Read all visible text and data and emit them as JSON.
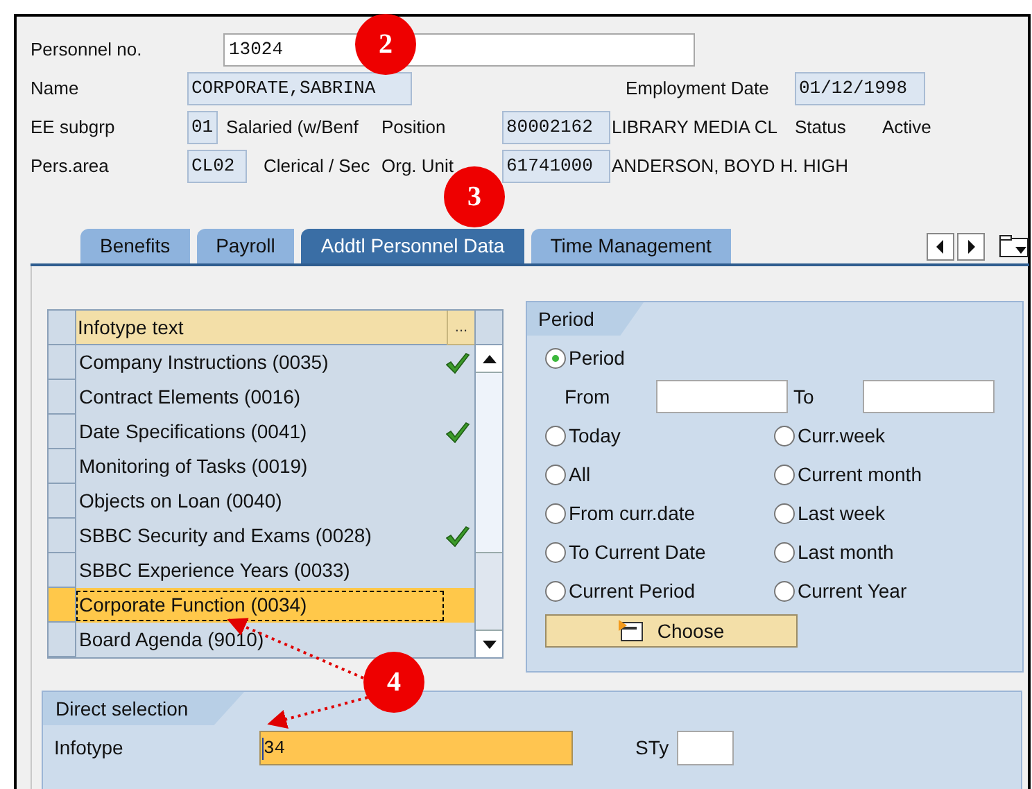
{
  "header": {
    "personnel_no": {
      "label": "Personnel no.",
      "value": "13024"
    },
    "name": {
      "label": "Name",
      "value": "CORPORATE,SABRINA"
    },
    "employment_date": {
      "label": "Employment Date",
      "value": "01/12/1998"
    },
    "ee_subgrp": {
      "label": "EE subgrp",
      "value": "01",
      "text": "Salaried (w/Benf"
    },
    "position": {
      "label": "Position",
      "value": "80002162",
      "text": "LIBRARY MEDIA CL"
    },
    "status": {
      "label": "Status",
      "text": "Active"
    },
    "pers_area": {
      "label": "Pers.area",
      "value": "CL02",
      "text": "Clerical / Sec"
    },
    "org_unit": {
      "label": "Org. Unit",
      "value": "61741000",
      "text": "ANDERSON, BOYD H. HIGH"
    }
  },
  "tabs": [
    {
      "label": "Benefits",
      "selected": false
    },
    {
      "label": "Payroll",
      "selected": false
    },
    {
      "label": "Addtl Personnel Data",
      "selected": true
    },
    {
      "label": "Time Management",
      "selected": false
    }
  ],
  "infotype_table": {
    "column": "Infotype text",
    "column_menu": "...",
    "rows": [
      {
        "text": "Company Instructions (0035)",
        "checked": true,
        "selected": false
      },
      {
        "text": "Contract Elements (0016)",
        "checked": false,
        "selected": false
      },
      {
        "text": "Date Specifications (0041)",
        "checked": true,
        "selected": false
      },
      {
        "text": "Monitoring of Tasks (0019)",
        "checked": false,
        "selected": false
      },
      {
        "text": "Objects on Loan (0040)",
        "checked": false,
        "selected": false
      },
      {
        "text": "SBBC Security and Exams (0028)",
        "checked": true,
        "selected": false
      },
      {
        "text": "SBBC Experience Years (0033)",
        "checked": false,
        "selected": false
      },
      {
        "text": "Corporate Function (0034)",
        "checked": false,
        "selected": true
      },
      {
        "text": "Board Agenda (9010)",
        "checked": false,
        "selected": false
      }
    ]
  },
  "period": {
    "title": "Period",
    "from_label": "From",
    "to_label": "To",
    "choose_button": "Choose",
    "options": [
      {
        "label": "Period",
        "selected": true
      },
      {
        "label": "Today",
        "selected": false
      },
      {
        "label": "Curr.week",
        "selected": false
      },
      {
        "label": "All",
        "selected": false
      },
      {
        "label": "Current month",
        "selected": false
      },
      {
        "label": "From curr.date",
        "selected": false
      },
      {
        "label": "Last week",
        "selected": false
      },
      {
        "label": "To Current Date",
        "selected": false
      },
      {
        "label": "Last month",
        "selected": false
      },
      {
        "label": "Current Period",
        "selected": false
      },
      {
        "label": "Current Year",
        "selected": false
      }
    ]
  },
  "direct_selection": {
    "title": "Direct selection",
    "infotype_label": "Infotype",
    "infotype_value": "34",
    "sty_label": "STy"
  },
  "callouts": [
    "2",
    "3",
    "4"
  ]
}
